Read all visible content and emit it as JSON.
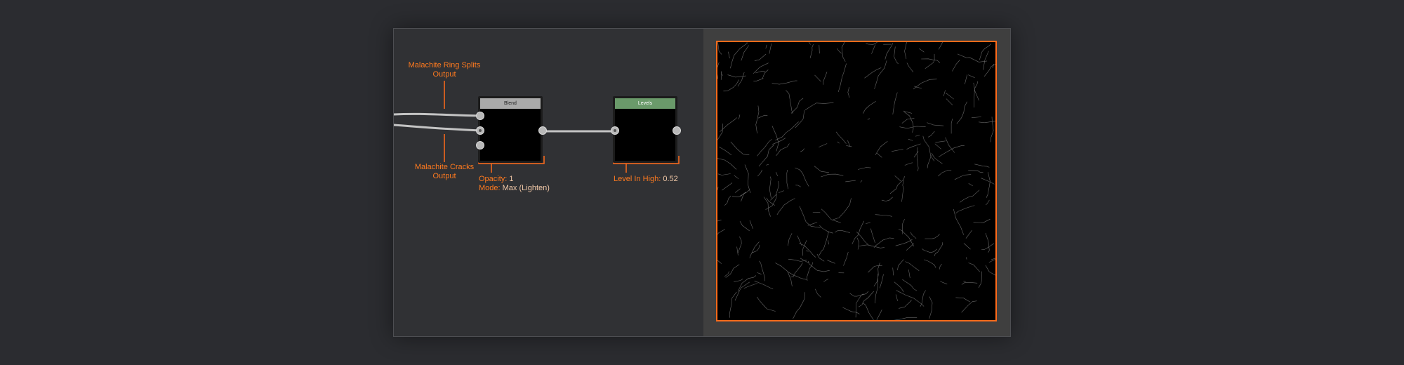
{
  "graph": {
    "nodes": {
      "blend": {
        "title": "Blend",
        "header_color": "#aaaaaa"
      },
      "levels": {
        "title": "Levels",
        "header_color": "#6a9a6a"
      }
    },
    "annotations": {
      "ring_splits": {
        "line1": "Malachite Ring Splits",
        "line2": "Output"
      },
      "cracks": {
        "line1": "Malachite Cracks",
        "line2": "Output"
      },
      "blend_params": {
        "opacity_label": "Opacity:",
        "opacity_value": "1",
        "mode_label": "Mode:",
        "mode_value": "Max (Lighten)"
      },
      "levels_params": {
        "label": "Level In High:",
        "value": "0.52"
      }
    }
  },
  "colors": {
    "accent": "#ff6a1a",
    "background": "#2b2c30",
    "panel": "#303134",
    "preview_panel": "#3f3f3f",
    "wire": "#c4c4c4"
  }
}
